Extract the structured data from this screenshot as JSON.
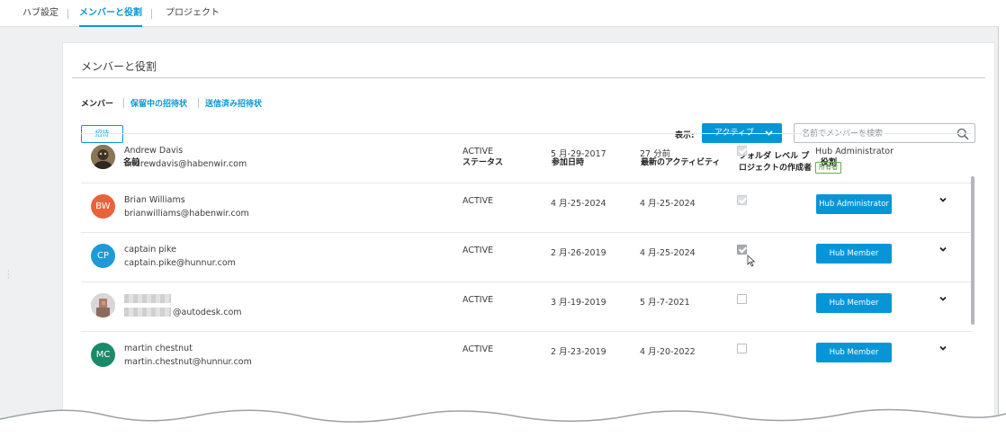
{
  "topnav": {
    "tabs": [
      {
        "label": "ハブ設定"
      },
      {
        "label": "メンバーと役割"
      },
      {
        "label": "プロジェクト"
      }
    ]
  },
  "panel": {
    "title": "メンバーと役割"
  },
  "subtabs": [
    {
      "label": "メンバー"
    },
    {
      "label": "保留中の招待状"
    },
    {
      "label": "送信済み招待状"
    }
  ],
  "toolbar": {
    "invite_label": "招待",
    "show_label": "表示:",
    "status_value": "アクティブ",
    "search_placeholder": "名前でメンバーを検索"
  },
  "table": {
    "headers": {
      "name": "名前",
      "status": "ステータス",
      "joined": "参加日時",
      "activity": "最新のアクティビティ",
      "folder_line1": "フォルダ レベル プ",
      "folder_line2": "ロジェクトの作成者",
      "role": "役割"
    },
    "rows": [
      {
        "initials": "",
        "avatar_color": "#7a6a55",
        "name": "Andrew Davis",
        "email": "andrewdavis@habenwir.com",
        "status": "ACTIVE",
        "joined": "5 月-29-2017",
        "activity": "27 分前",
        "folder_creator": true,
        "role": "Hub Administrator",
        "badge": "所有者"
      },
      {
        "initials": "BW",
        "avatar_color": "#e8623a",
        "name": "Brian Williams",
        "email": "brianwilliams@habenwir.com",
        "status": "ACTIVE",
        "joined": "4 月-25-2024",
        "activity": "4 月-25-2024",
        "folder_creator": true,
        "role": "Hub Administrator"
      },
      {
        "initials": "CP",
        "avatar_color": "#1e9ad8",
        "name": "captain pike",
        "email": "captain.pike@hunnur.com",
        "status": "ACTIVE",
        "joined": "2 月-26-2019",
        "activity": "4 月-25-2024",
        "folder_creator": true,
        "role": "Hub Member"
      },
      {
        "initials": "",
        "avatar_color": "#c9b8b4",
        "name": "",
        "email": "@autodesk.com",
        "status": "ACTIVE",
        "joined": "3 月-19-2019",
        "activity": "5 月-7-2021",
        "folder_creator": false,
        "role": "Hub Member"
      },
      {
        "initials": "MC",
        "avatar_color": "#1a8a6a",
        "name": "martin chestnut",
        "email": "martin.chestnut@hunnur.com",
        "status": "ACTIVE",
        "joined": "2 月-23-2019",
        "activity": "4 月-20-2022",
        "folder_creator": false,
        "role": "Hub Member"
      }
    ]
  },
  "colors": {
    "accent": "#0696d7",
    "text": "#3c3c3c"
  }
}
